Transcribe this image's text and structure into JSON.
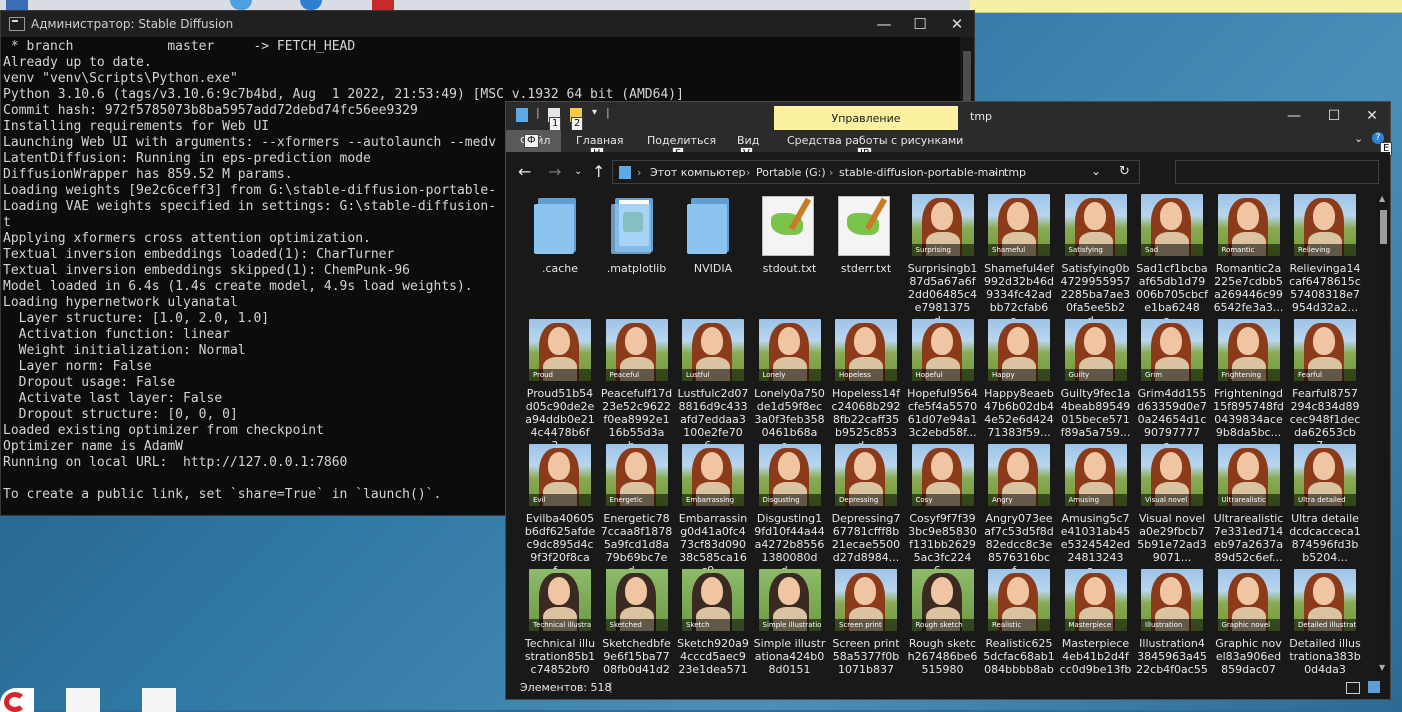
{
  "console": {
    "title": "Администратор: Stable Diffusion",
    "lines": [
      " * branch            master     -> FETCH_HEAD",
      "Already up to date.",
      "venv \"venv\\Scripts\\Python.exe\"",
      "Python 3.10.6 (tags/v3.10.6:9c7b4bd, Aug  1 2022, 21:53:49) [MSC v.1932 64 bit (AMD64)]",
      "Commit hash: 972f5785073b8ba5957add72debd74fc56ee9329",
      "Installing requirements for Web UI",
      "Launching Web UI with arguments: --xformers --autolaunch --medv",
      "LatentDiffusion: Running in eps-prediction mode",
      "DiffusionWrapper has 859.52 M params.",
      "Loading weights [9e2c6ceff3] from G:\\stable-diffusion-portable-",
      "Loading VAE weights specified in settings: G:\\stable-diffusion-",
      "t",
      "Applying xformers cross attention optimization.",
      "Textual inversion embeddings loaded(1): CharTurner",
      "Textual inversion embeddings skipped(1): ChemPunk-96",
      "Model loaded in 6.4s (1.4s create model, 4.9s load weights).",
      "Loading hypernetwork ulyanatal",
      "  Layer structure: [1.0, 2.0, 1.0]",
      "  Activation function: linear",
      "  Weight initialization: Normal",
      "  Layer norm: False",
      "  Dropout usage: False",
      "  Activate last layer: False",
      "  Dropout structure: [0, 0, 0]",
      "Loaded existing optimizer from checkpoint",
      "Optimizer name is AdamW",
      "Running on local URL:  http://127.0.0.1:7860",
      "",
      "To create a public link, set `share=True` in `launch()`."
    ],
    "controls": {
      "minimize": "—",
      "maximize": "☐",
      "close": "✕"
    }
  },
  "explorer": {
    "window_title": "tmp",
    "manage_tab": "Управление",
    "qa_keytips": [
      "1",
      "2"
    ],
    "ribbon": {
      "file": "Файл",
      "home": "Главная",
      "share": "Поделиться",
      "view": "Вид",
      "picture_tools": "Средства работы с рисунками",
      "keytips": {
        "file": "Ф",
        "home": "Н",
        "share": "S",
        "view": "V",
        "picture_tools": "JP",
        "help": "E"
      }
    },
    "breadcrumb": [
      "Этот компьютер",
      "Portable (G:)",
      "stable-diffusion-portable-main",
      "tmp"
    ],
    "search_placeholder": "",
    "status": "Элементов: 518",
    "controls": {
      "minimize": "—",
      "maximize": "☐",
      "close": "✕"
    },
    "items": [
      {
        "kind": "folder",
        "name": ".cache"
      },
      {
        "kind": "folder-file",
        "name": ".matplotlib"
      },
      {
        "kind": "folder",
        "name": "NVIDIA"
      },
      {
        "kind": "txt",
        "name": "stdout.txt"
      },
      {
        "kind": "txt",
        "name": "stderr.txt"
      },
      {
        "kind": "img",
        "caption": "Surprising",
        "name": "Surprisingb187d5a67a6f2dd06485c4e7981375d..."
      },
      {
        "kind": "img",
        "caption": "Shameful",
        "name": "Shameful4ef992d32b46d9334fc42adbb72cfab6a..."
      },
      {
        "kind": "img",
        "caption": "Satisfying",
        "name": "Satisfying0b47299559572285ba7ae30fa5ee5b2d..."
      },
      {
        "kind": "img",
        "caption": "Sad",
        "name": "Sad1cf1bcbaaf65db1d79006b705cbcfe1ba6248a..."
      },
      {
        "kind": "img",
        "caption": "Romantic",
        "name": "Romantic2a225e7cdbb5a269446c996542fe3a3..."
      },
      {
        "kind": "img",
        "caption": "Relieving",
        "name": "Relievinga14caf6478615c57408318e7954d32a2..."
      },
      {
        "kind": "img",
        "caption": "Proud",
        "name": "Proud51b54d05c90de2ea94ddb0e214c4478b6f3..."
      },
      {
        "kind": "img",
        "caption": "Peaceful",
        "name": "Peacefulf17d23e52c9622f0ea8992e116b55d3ab..."
      },
      {
        "kind": "img",
        "caption": "Lustful",
        "name": "Lustfulc2d078816d9c433afd7eddaa3100e2fe706..."
      },
      {
        "kind": "img",
        "caption": "Lonely",
        "name": "Lonely0a750de1d59f8ec3a0f3feb3580461b68ae..."
      },
      {
        "kind": "img",
        "caption": "Hopeless",
        "name": "Hopeless14fc24068b2928fb22caff35b9525c853d..."
      },
      {
        "kind": "img",
        "caption": "Hopeful",
        "name": "Hopeful9564cfe5f4a557061d07e94a13c2ebd58f..."
      },
      {
        "kind": "img",
        "caption": "Happy",
        "name": "Happy8eaeb47b6b02db44e52e6d42471383f59..."
      },
      {
        "kind": "img",
        "caption": "Guilty",
        "name": "Guilty9fec1a4beab89549015bece571f89a5a759..."
      },
      {
        "kind": "img",
        "caption": "Grim",
        "name": "Grim4dd155d63359d0e70a24654d1c90797777a..."
      },
      {
        "kind": "img",
        "caption": "Frightening",
        "name": "Frighteningd15f895748fd0439834ace9b8da5bc..."
      },
      {
        "kind": "img",
        "caption": "Fearful",
        "name": "Fearful8757294c834d89cec948f1decda62653cb7..."
      },
      {
        "kind": "img",
        "caption": "Evil",
        "name": "Evilba40605b6df625afdec9dc895d4c9f3f20f8caf..."
      },
      {
        "kind": "img",
        "caption": "Energetic",
        "name": "Energetic787ccaa8f18785a9fcd1d8a79b69bc7ed..."
      },
      {
        "kind": "img",
        "caption": "Embarrassing",
        "name": "Embarrassing0d41a0fc473cf83d09038c585ca16c9..."
      },
      {
        "kind": "img",
        "caption": "Disgusting",
        "name": "Disgusting19fd10f44a44a4272b85561380080dd..."
      },
      {
        "kind": "img",
        "caption": "Depressing",
        "name": "Depressing767781cfff8b21ecae5500d27d8984..."
      },
      {
        "kind": "img",
        "caption": "Cosy",
        "name": "Cosyf9f7f393bc9e85830f131bb26295ac3fc2246..."
      },
      {
        "kind": "img",
        "caption": "Angry",
        "name": "Angry073eeaf7c53d5f8d82edcc8c3e8576316bcf..."
      },
      {
        "kind": "img",
        "caption": "Amusing",
        "name": "Amusing5c7e41031ab45e5324542ed24813243a..."
      },
      {
        "kind": "img",
        "caption": "Visual novel",
        "name": "Visual novela0e29fbcb75b91e72ad39071..."
      },
      {
        "kind": "img",
        "caption": "Ultrarealistic",
        "name": "Ultrarealistic7e331ed714eb97a2637a89d52c6ef..."
      },
      {
        "kind": "img",
        "caption": "Ultra detailed",
        "name": "Ultra detailedcdcacceca1874596fd3bb5204..."
      },
      {
        "kind": "sketch",
        "caption": "Technical illustration",
        "name": "Technical illustration85b1c74852bf0"
      },
      {
        "kind": "sketch",
        "caption": "Sketched",
        "name": "Sketchedbfe9e6f15ba7708fb0d41d2e3"
      },
      {
        "kind": "sketch",
        "caption": "Sketch",
        "name": "Sketch920a94cccd5aec923e1dea571b"
      },
      {
        "kind": "sketch",
        "caption": "Simple illustration",
        "name": "Simple illustrationa424b08d0151"
      },
      {
        "kind": "img",
        "caption": "Screen print",
        "name": "Screen print58a5377f0b1071b837"
      },
      {
        "kind": "sketch",
        "caption": "Rough sketch",
        "name": "Rough sketch267486be6515980"
      },
      {
        "kind": "img",
        "caption": "Realistic",
        "name": "Realistic6255dcfac68ab1084bbbb8abc"
      },
      {
        "kind": "img",
        "caption": "Masterpiece",
        "name": "Masterpiece4eb41b2d4fcc0d9be13fbc0"
      },
      {
        "kind": "img",
        "caption": "Illustration",
        "name": "Illustration43845963a4522cb4f0ac551"
      },
      {
        "kind": "img",
        "caption": "Graphic novel",
        "name": "Graphic novel83a906ed859dac07"
      },
      {
        "kind": "img",
        "caption": "Detailed illustration",
        "name": "Detailed illustrationa383b0d4da3"
      }
    ]
  },
  "colors": {
    "manage_tab": "#fbf1a1",
    "console_bg": "#0c0c0c",
    "explorer_bg": "#191919"
  }
}
